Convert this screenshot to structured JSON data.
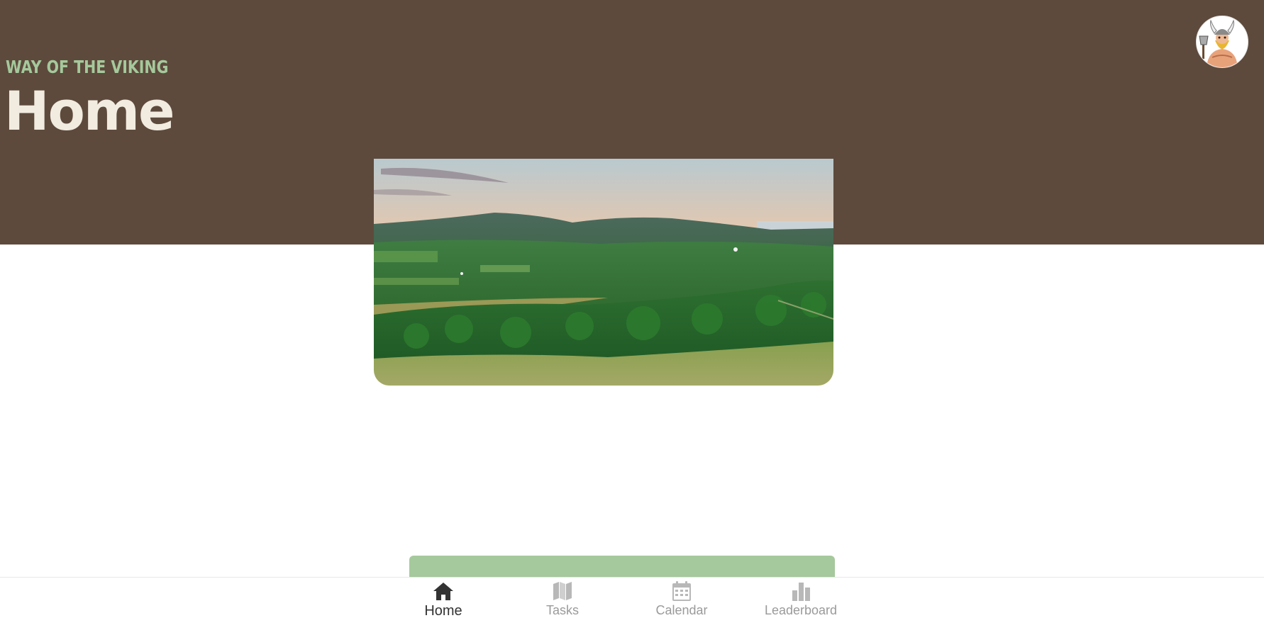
{
  "header": {
    "brand": "WAY OF THE VIKING",
    "title": "Home",
    "avatar_icon": "viking-avatar-icon"
  },
  "hero": {
    "image": "landscape-hills-sunset"
  },
  "tabs": [
    {
      "id": "home",
      "label": "Home",
      "icon": "house-icon",
      "active": true
    },
    {
      "id": "tasks",
      "label": "Tasks",
      "icon": "map-icon",
      "active": false
    },
    {
      "id": "calendar",
      "label": "Calendar",
      "icon": "calendar-icon",
      "active": false
    },
    {
      "id": "leaderboard",
      "label": "Leaderboard",
      "icon": "bar-chart-icon",
      "active": false
    }
  ],
  "colors": {
    "header_bg": "#5d4a3c",
    "brand": "#a5c99c",
    "title": "#f2ece0",
    "card_green": "#a5c99c",
    "tab_active": "#333333",
    "tab_inactive": "#9a9a9a"
  }
}
